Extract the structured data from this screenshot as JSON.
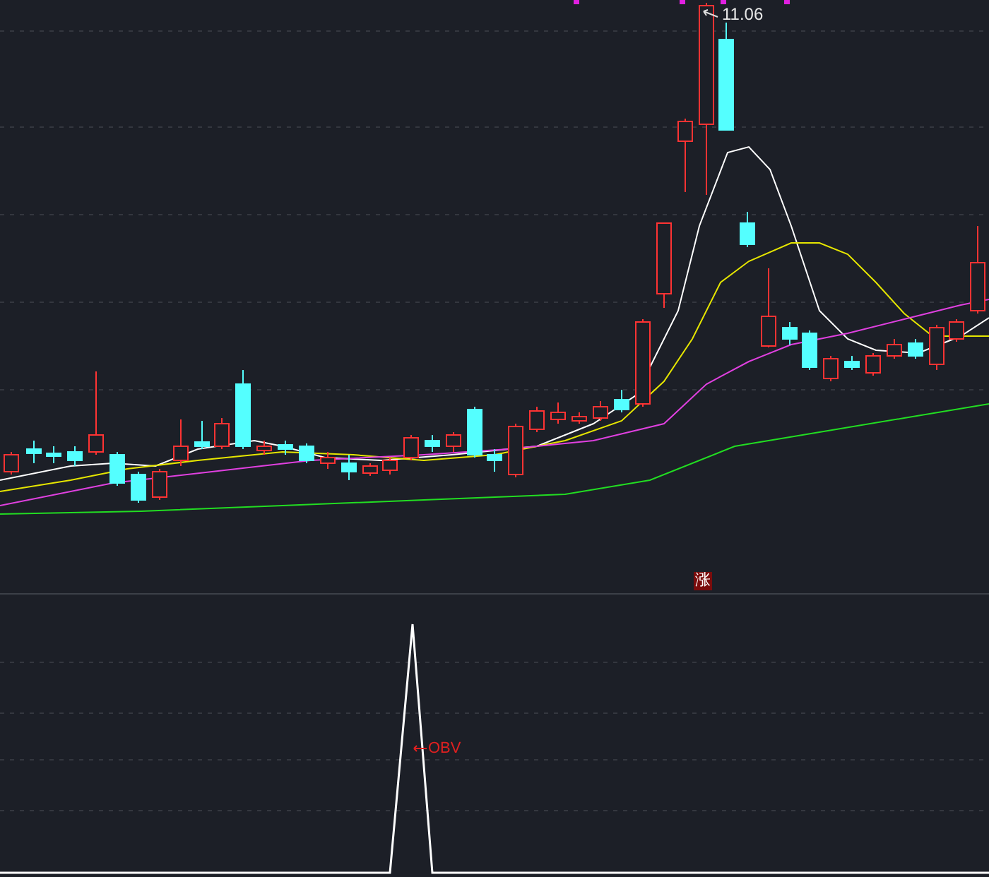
{
  "price_panel": {
    "high_label": "11.06",
    "badge": "涨"
  },
  "indicator_panel": {
    "label": "OBV"
  }
}
